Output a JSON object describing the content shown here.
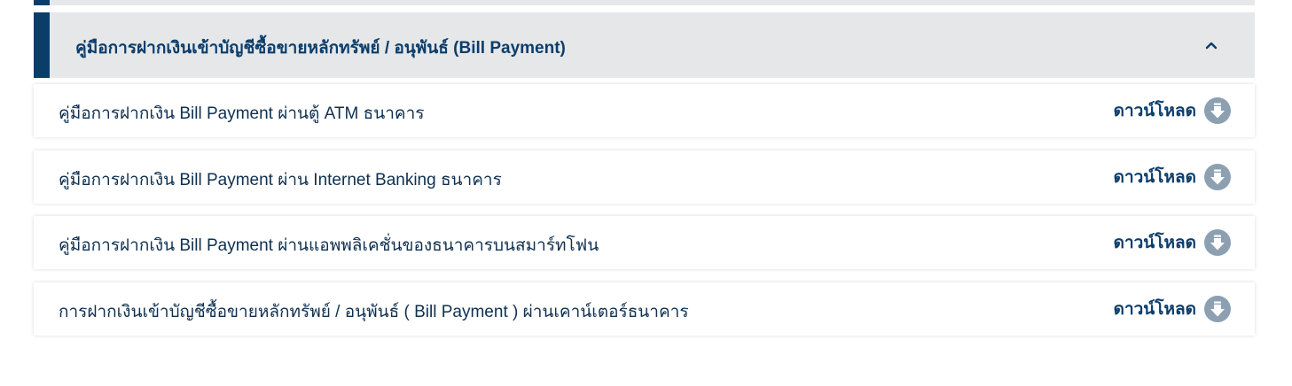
{
  "accordion": {
    "title": "คู่มือการฝากเงินเข้าบัญชีซื้อขายหลักทรัพย์ / อนุพันธ์ (Bill Payment)",
    "expanded": true,
    "accent_color": "#0b3d6b",
    "header_bg": "#e6e7e9"
  },
  "items": [
    {
      "label": "คู่มือการฝากเงิน Bill Payment ผ่านตู้ ATM ธนาคาร",
      "action": "ดาวน์โหลด"
    },
    {
      "label": "คู่มือการฝากเงิน Bill Payment ผ่าน Internet Banking ธนาคาร",
      "action": "ดาวน์โหลด"
    },
    {
      "label": "คู่มือการฝากเงิน Bill Payment ผ่านแอพพลิเคชั่นของธนาคารบนสมาร์ทโฟน",
      "action": "ดาวน์โหลด"
    },
    {
      "label": "การฝากเงินเข้าบัญชีซื้อขายหลักทรัพย์ / อนุพันธ์ ( Bill Payment ) ผ่านเคาน์เตอร์ธนาคาร",
      "action": "ดาวน์โหลด"
    }
  ],
  "icons": {
    "header_toggle": "chevron-up-icon",
    "download": "download-arrow-icon"
  }
}
